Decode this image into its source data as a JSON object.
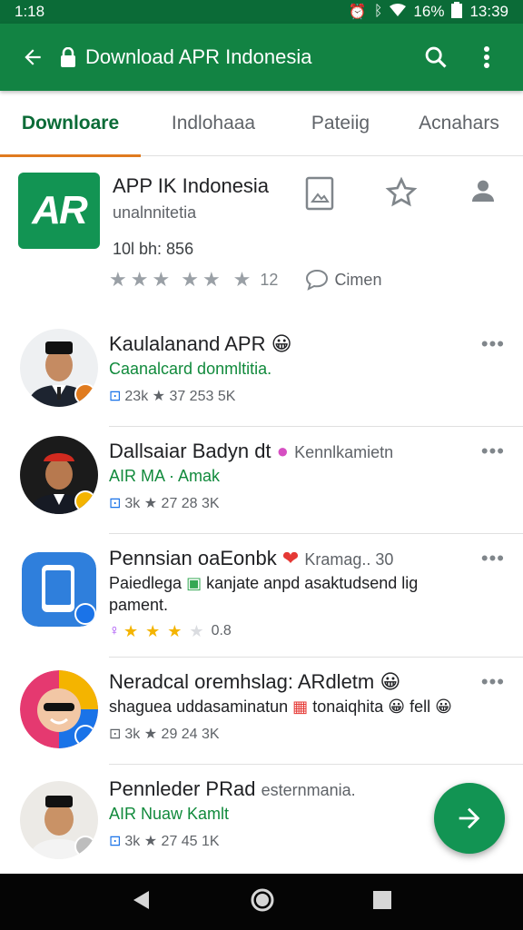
{
  "status_bar": {
    "time_left": "1:18",
    "battery": "16%",
    "time_right": "13:39"
  },
  "app_bar": {
    "title": "Download APR Indonesia",
    "back_icon": "arrow-left-icon",
    "search_icon": "search-icon",
    "menu_icon": "more-vert-icon"
  },
  "tabs": [
    {
      "label": "Downloare",
      "active": true
    },
    {
      "label": "Indlohaaa",
      "active": false
    },
    {
      "label": "Pateiig",
      "active": false
    },
    {
      "label": "Acnahars",
      "active": false
    }
  ],
  "app": {
    "logo_text": "AR",
    "name": "APP IK Indonesia",
    "developer": "unalnnitetia",
    "size": "10l bh: 856",
    "rating_count": "12",
    "comment_label": "Cimen"
  },
  "colors": {
    "primary": "#128343",
    "status": "#0b6b37",
    "accent": "#e07b1f",
    "link_green": "#118a3c"
  },
  "list": [
    {
      "title": "Kaulalanand APR",
      "subtitle": "Caanalcard donmltitia.",
      "meta": "23k ★ 37 253 5K"
    },
    {
      "title": "Dallsaiar Badyn dt",
      "tag": "Kennlkamietn",
      "subtitle": "AIR MA · Amak",
      "meta": "3k ★ 27 28 3K"
    },
    {
      "title": "Pennsian oaEonbk",
      "tag": "Kramag.. 30",
      "subtitle": "Paiedlega",
      "subtitle_rest": "kanjate anpd asaktudsend lig",
      "subtitle2": "pament.",
      "meta": "0.8"
    },
    {
      "title": "Neradcal oremhslag: ARdletm",
      "subtitle": "shaguea uddasaminatun",
      "subtitle_rest": "tonaiqhita",
      "subtitle_end": "fell",
      "meta": "3k ★ 29 24 3K"
    },
    {
      "title": "Pennleder PRad",
      "tag": "esternmania.",
      "subtitle": "AIR Nuaw Kamlt",
      "meta": "3k ★ 27 45 1K"
    }
  ]
}
